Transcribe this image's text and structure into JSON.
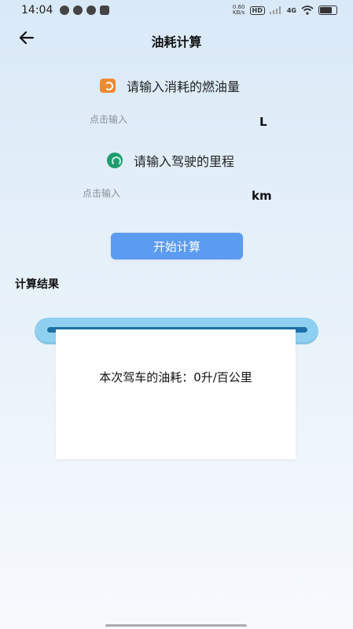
{
  "status_bar": {
    "time": "14:04",
    "net_speed_value": "0.60",
    "net_speed_unit": "KB/s",
    "hd_badge": "HD",
    "signal_label": "4G"
  },
  "header": {
    "title": "油耗计算"
  },
  "fuel_input": {
    "prompt": "请输入消耗的燃油量",
    "placeholder": "点击输入",
    "value": "",
    "unit": "L",
    "icon": "fuel-gauge-icon",
    "icon_color": "#f08a30"
  },
  "distance_input": {
    "prompt": "请输入驾驶的里程",
    "placeholder": "点击输入",
    "value": "",
    "unit": "km",
    "icon": "odometer-icon",
    "icon_color": "#1f9d6e"
  },
  "calculate_button": {
    "label": "开始计算",
    "color": "#5b9bf1"
  },
  "result": {
    "heading": "计算结果",
    "text": "本次驾车的油耗：0升/百公里"
  }
}
